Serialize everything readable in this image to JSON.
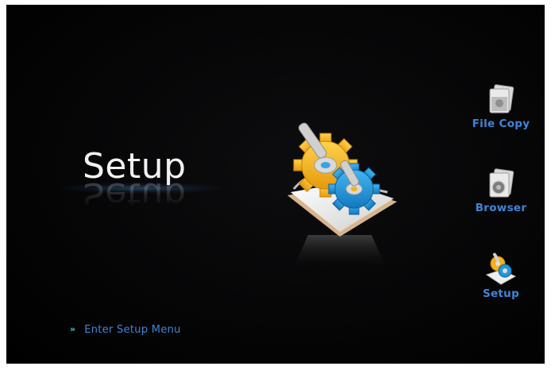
{
  "screen": {
    "title": "Setup",
    "hero_icon": "setup-gears-icon",
    "hint": {
      "chevron": "»",
      "text": "Enter Setup Menu"
    }
  },
  "menu": {
    "items": [
      {
        "label": "File Copy",
        "icon": "file-copy-icon"
      },
      {
        "label": "Browser",
        "icon": "browser-icon"
      },
      {
        "label": "Setup",
        "icon": "setup-icon"
      }
    ]
  },
  "colors": {
    "background": "#000000",
    "accent_blue": "#3b86d6",
    "chevron_cyan": "#3fd0d6",
    "title_white": "#f2f2f2",
    "gear_yellow": "#f4b21b",
    "gear_blue": "#1f9ad8"
  }
}
